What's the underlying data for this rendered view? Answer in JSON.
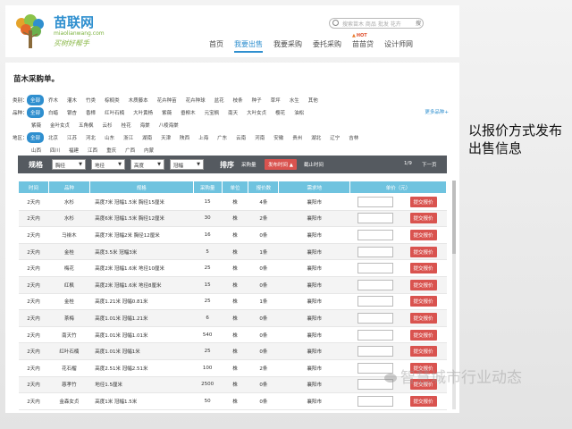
{
  "header": {
    "brand": "苗联网",
    "domain": "miaolianwang.com",
    "slogan": "买树好帮手",
    "search_placeholder": "搜索苗木  商品  批发  花卉",
    "search_button": "搜",
    "hot_badge": "HOT",
    "nav": [
      "首页",
      "我要出售",
      "我要采购",
      "委托采购",
      "苗苗贷",
      "设计师网"
    ],
    "nav_active_index": 1
  },
  "page": {
    "title": "苗木采购单。"
  },
  "filters": {
    "category": {
      "label": "类别：",
      "options": [
        "全部",
        "乔木",
        "灌木",
        "竹类",
        "棕榈类",
        "木质藤本",
        "花卉种苗",
        "花卉种球",
        "盆花",
        "枝条",
        "种子",
        "草坪",
        "水生",
        "其他"
      ]
    },
    "variety": {
      "label": "品种：",
      "options": [
        "全部",
        "白蜡",
        "银杏",
        "香樟",
        "红叶石楠",
        "大叶黄杨",
        "紫薇",
        "垂柳木",
        "元宝枫",
        "南天",
        "大叶女贞",
        "樱花",
        "油松"
      ],
      "options_row2": [
        "紫薇",
        "金叶女贞",
        "五角枫",
        "云杉",
        "桂花",
        "海棠",
        "八棱海棠"
      ],
      "more": "更多品种+"
    },
    "region": {
      "label": "地区：",
      "options": [
        "全部",
        "北京",
        "江苏",
        "河北",
        "山东",
        "浙江",
        "湖南",
        "天津",
        "陕西",
        "上海",
        "广东",
        "云南",
        "河南",
        "安徽",
        "贵州",
        "湖北",
        "辽宁",
        "吉林"
      ],
      "options_row2": [
        "山西",
        "四川",
        "福建",
        "江西",
        "重庆",
        "广西",
        "内蒙"
      ]
    }
  },
  "toolbar": {
    "spec_label": "规格",
    "selects": [
      "胸径",
      "地径",
      "高度",
      "冠幅"
    ],
    "sort_label": "排序",
    "sort_option": "采购量",
    "publish_time": "发布时间",
    "deadline": "截止时间",
    "page_info": "1/9",
    "next_page": "下一页"
  },
  "table": {
    "columns": [
      "时间",
      "品种",
      "规格",
      "采购量",
      "单位",
      "报价数",
      "需求地",
      "单价（元）",
      ""
    ],
    "quote_label": "提交报价",
    "rows": [
      [
        "2天内",
        "水杉",
        "高度7米  冠幅1.5米  胸径15厘米",
        "15",
        "株",
        "4条",
        "襄阳市"
      ],
      [
        "2天内",
        "水杉",
        "高度6米  冠幅1.5米  胸径12厘米",
        "30",
        "株",
        "2条",
        "襄阳市"
      ],
      [
        "2天内",
        "马褂木",
        "高度7米  冠幅2米  胸径12厘米",
        "16",
        "株",
        "0条",
        "襄阳市"
      ],
      [
        "2天内",
        "金桂",
        "高度3.5米  冠幅3米",
        "5",
        "株",
        "1条",
        "襄阳市"
      ],
      [
        "2天内",
        "梅花",
        "高度2米  冠幅1.6米  地径10厘米",
        "25",
        "株",
        "0条",
        "襄阳市"
      ],
      [
        "2天内",
        "红枫",
        "高度2米  冠幅1.6米  地径8厘米",
        "15",
        "株",
        "0条",
        "襄阳市"
      ],
      [
        "2天内",
        "金桂",
        "高度1.21米  冠幅0.81米",
        "25",
        "株",
        "1条",
        "襄阳市"
      ],
      [
        "2天内",
        "茶梅",
        "高度1.01米  冠幅1.21米",
        "6",
        "株",
        "0条",
        "襄阳市"
      ],
      [
        "2天内",
        "南天竹",
        "高度1.01米  冠幅1.01米",
        "540",
        "株",
        "0条",
        "襄阳市"
      ],
      [
        "2天内",
        "红叶石楠",
        "高度1.01米  冠幅1米",
        "25",
        "株",
        "0条",
        "襄阳市"
      ],
      [
        "2天内",
        "花石榴",
        "高度2.51米  冠幅2.51米",
        "100",
        "株",
        "2条",
        "襄阳市"
      ],
      [
        "2天内",
        "慈孝竹",
        "地径1.5厘米",
        "2500",
        "株",
        "0条",
        "襄阳市"
      ],
      [
        "2天内",
        "金森女贞",
        "高度1米  冠幅1.5米",
        "50",
        "株",
        "0条",
        "襄阳市"
      ]
    ]
  },
  "caption": "以报价方式发布出售信息",
  "watermark": "智慧城市行业动态"
}
